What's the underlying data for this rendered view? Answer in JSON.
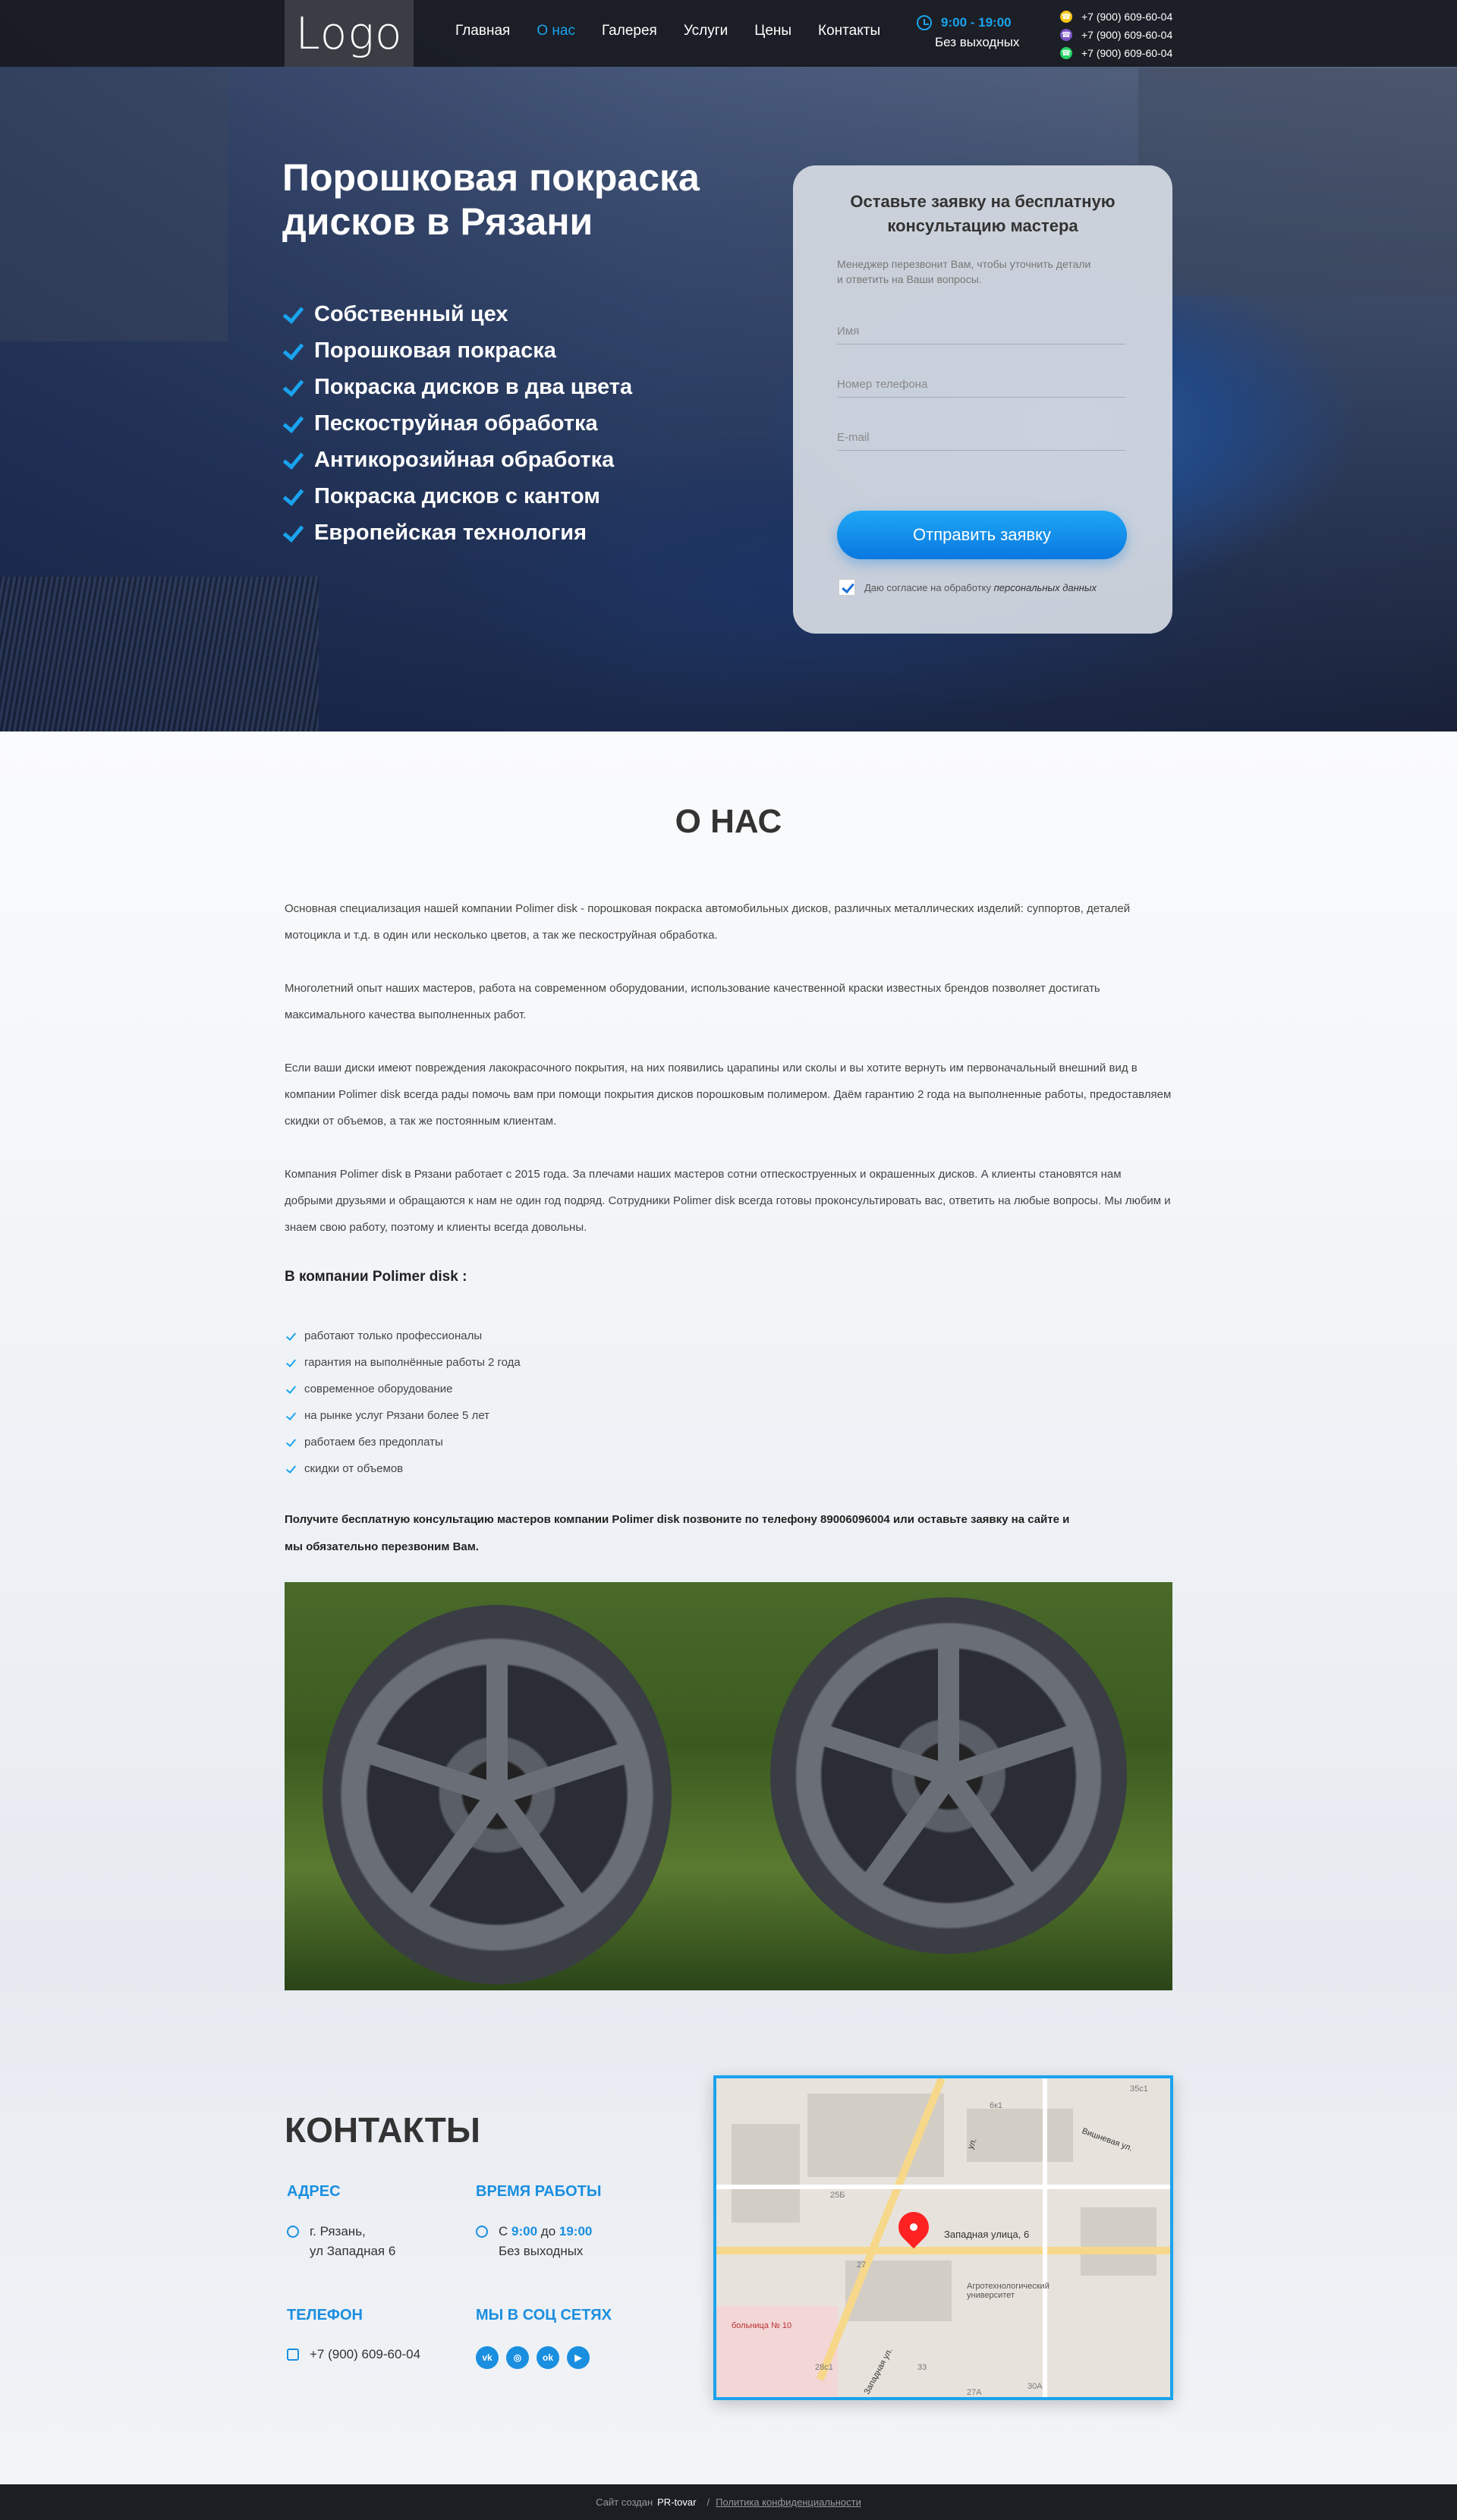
{
  "header": {
    "logo": "Logo",
    "nav": [
      "Главная",
      "О нас",
      "Галерея",
      "Услуги",
      "Цены",
      "Контакты"
    ],
    "hours": "9:00 - 19:00",
    "hours_note": "Без выходных",
    "phones": [
      "+7 (900) 609-60-04",
      "+7 (900) 609-60-04",
      "+7 (900) 609-60-04"
    ]
  },
  "hero": {
    "title": "Порошковая покраска дисков в Рязани",
    "features": [
      "Собственный цех",
      "Порошковая покраска",
      "Покраска дисков в два цвета",
      "Пескоструйная обработка",
      "Антикорозийная обработка",
      "Покраска дисков с кантом",
      "Европейская технология"
    ]
  },
  "form": {
    "title": "Оставьте заявку на бесплатную консультацию мастера",
    "desc": "Менеджер перезвонит Вам, чтобы уточнить детали и ответить на Ваши вопросы.",
    "name_ph": "Имя",
    "phone_ph": "Номер телефона",
    "email_ph": "E-mail",
    "submit": "Отправить заявку",
    "agree": "Даю согласие на обработку",
    "agree_link": "персональных данных"
  },
  "about": {
    "title": "О НАС",
    "p1": "Основная специализация нашей компании Polimer disk - порошковая покраска автомобильных дисков, различных металлических изделий: суппортов, деталей мотоцикла и т.д. в один или несколько цветов, а так же пескоструйная обработка.",
    "p2": "Многолетний опыт наших мастеров, работа на современном оборудовании, использование качественной краски известных брендов позволяет достигать максимального качества выполненных работ.",
    "p3": "Если ваши диски имеют повреждения лакокрасочного покрытия, на них появились царапины или сколы и вы хотите вернуть им первоначальный внешний вид в компании Polimer disk всегда рады помочь вам при помощи покрытия дисков порошковым полимером. Даём гарантию 2 года на выполненные работы, предоставляем скидки от объемов, а так же постоянным клиентам.",
    "p4": "Компания Polimer disk в Рязани работает с 2015 года. За плечами наших мастеров сотни отпескоструенных и окрашенных дисков. А клиенты становятся нам добрыми друзьями и обращаются к нам не один год подряд. Сотрудники Polimer disk всегда готовы проконсультировать вас, ответить на любые вопросы. Мы любим и знаем свою работу, поэтому и клиенты всегда довольны.",
    "subtitle": "В компании Polimer disk :",
    "list": [
      "работают только профессионалы",
      "гарантия на выполнённые работы 2 года",
      "современное оборудование",
      "на рынке услуг Рязани более 5 лет",
      "работаем без предоплаты",
      "скидки от объемов"
    ],
    "cta": "Получите бесплатную консультацию мастеров компании Polimer disk позвоните по телефону 89006096004 или оставьте заявку на сайте и мы обязательно перезвоним Вам."
  },
  "contacts": {
    "title": "КОНТАКТЫ",
    "address_h": "АДРЕС",
    "address": "г. Рязань,",
    "address2": "ул Западная 6",
    "hours_h": "ВРЕМЯ РАБОТЫ",
    "hours_from": "С",
    "hours_open": "9:00",
    "hours_to": "до",
    "hours_close": "19:00",
    "hours_note": "Без выходных",
    "phone_h": "ТЕЛЕФОН",
    "phone": "+7 (900) 609-60-04",
    "social_h": "МЫ В СОЦ СЕТЯХ",
    "social": [
      "vk",
      "ig",
      "ok",
      "yt"
    ]
  },
  "map": {
    "pin_label": "Западная улица, 6",
    "poi": "Агротехнологический университет",
    "clinic": "больница № 10",
    "street1": "Вишневая ул.",
    "street2": "ул.",
    "street3": "Западная ул.",
    "n1": "25Б",
    "n2": "27",
    "n3": "33",
    "n4": "28с1",
    "n5": "30А",
    "n6": "27А",
    "n7": "6к1",
    "n8": "35с1"
  },
  "footer": {
    "made": "Сайт создан",
    "author": "PR-tovar",
    "sep": "/",
    "policy": "Политика конфиденциальности"
  },
  "colors": {
    "accent": "#1aa3ee",
    "header": "#1b1e23"
  }
}
